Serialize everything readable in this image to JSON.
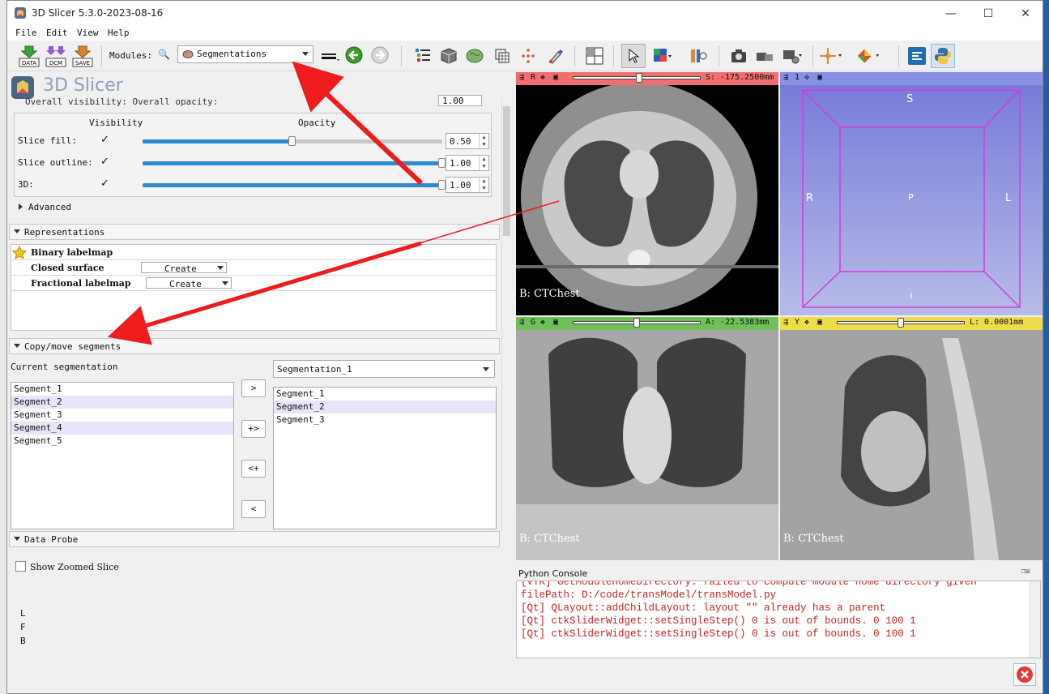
{
  "window": {
    "title": "3D Slicer 5.3.0-2023-08-16"
  },
  "menu": [
    "File",
    "Edit",
    "View",
    "Help"
  ],
  "toolbar": {
    "data_label": "DATA",
    "dcm_label": "DCM",
    "save_label": "SAVE",
    "modules_label": "Modules:",
    "module_selected": "Segmentations"
  },
  "module_panel": {
    "logo_text": "3D Slicer",
    "top_partial": "Overall visibility:   Overall opacity:",
    "top_partial_value": "1.00",
    "display": {
      "visibility_header": "Visibility",
      "opacity_header": "Opacity",
      "rows": [
        {
          "label": "Slice fill:",
          "checked": "✓",
          "value": "0.50",
          "fraction": 0.5
        },
        {
          "label": "Slice outline:",
          "checked": "✓",
          "value": "1.00",
          "fraction": 1.0
        },
        {
          "label": "3D:",
          "checked": "✓",
          "value": "1.00",
          "fraction": 1.0
        }
      ],
      "advanced": "Advanced"
    },
    "representations": {
      "header": "Representations",
      "rows": [
        {
          "name": "Binary labelmap",
          "button": ""
        },
        {
          "name": "Closed surface",
          "button": "Create"
        },
        {
          "name": "Fractional labelmap",
          "button": "Create"
        }
      ]
    },
    "copy_move": {
      "header": "Copy/move segments",
      "current_label": "Current segmentation",
      "target_segmentation": "Segmentation_1",
      "left_list": [
        "Segment_1",
        "Segment_2",
        "Segment_3",
        "Segment_4",
        "Segment_5"
      ],
      "left_selected": [
        1,
        3
      ],
      "right_list": [
        "Segment_1",
        "Segment_2",
        "Segment_3"
      ],
      "right_selected": [
        1
      ],
      "buttons": [
        ">",
        "+>",
        "<+",
        "<"
      ]
    },
    "data_probe": {
      "header": "Data Probe",
      "show_zoomed": "Show Zoomed Slice",
      "info": [
        "L",
        "F",
        "B"
      ]
    }
  },
  "views": {
    "red": {
      "letter": "R",
      "offset": "S: -175.2500mm",
      "label": "B: CTChest",
      "slider_fraction": 0.52,
      "color": "#f16e6e"
    },
    "threed": {
      "letter": "1",
      "color": "#8a8fe6",
      "labels": {
        "top": "S",
        "left": "R",
        "right": "L",
        "center": "P",
        "bottom": "I"
      }
    },
    "green": {
      "letter": "G",
      "offset": "A: -22.5383mm",
      "label": "B: CTChest",
      "slider_fraction": 0.5,
      "color": "#6fbf5a"
    },
    "yellow": {
      "letter": "Y",
      "offset": "L: 0.0001mm",
      "label": "B: CTChest",
      "slider_fraction": 0.5,
      "color": "#eddd4b"
    }
  },
  "python_console": {
    "title": "Python Console",
    "lines": [
      "[VTK] GetModuleHomeDirectory: failed to compute module home directory given",
      "filePath: D:/code/transModel/transModel.py",
      "[Qt] QLayout::addChildLayout: layout \"\" already has a parent",
      "[Qt] ctkSliderWidget::setSingleStep()  0 is out of bounds. 0 100 1",
      "[Qt] ctkSliderWidget::setSingleStep()  0 is out of bounds. 0 100 1"
    ]
  }
}
